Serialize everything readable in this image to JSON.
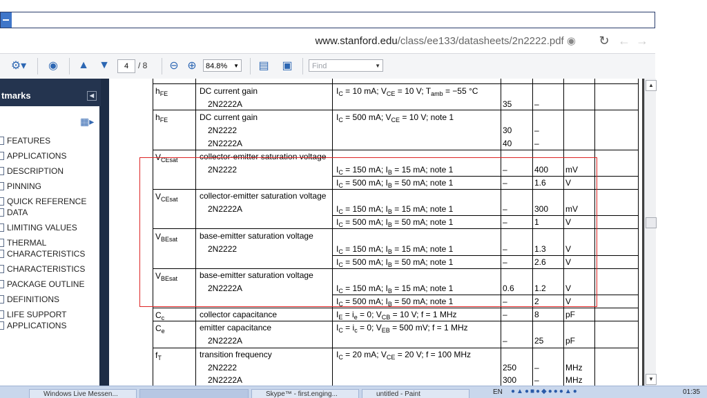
{
  "browser": {
    "url_host": "www.stanford.edu",
    "url_path": "/class/ee133/datasheets/2n2222.pdf"
  },
  "toolbar": {
    "page_current": "4",
    "page_total": "/ 8",
    "zoom": "84.8%",
    "find_placeholder": "Find"
  },
  "sidebar": {
    "title": "tmarks",
    "bookmarks": [
      "FEATURES",
      "APPLICATIONS",
      "DESCRIPTION",
      "PINNING",
      "QUICK REFERENCE",
      "DATA",
      "LIMITING VALUES",
      "THERMAL",
      "CHARACTERISTICS",
      "CHARACTERISTICS",
      "PACKAGE OUTLINE",
      "DEFINITIONS",
      "LIFE SUPPORT",
      "APPLICATIONS"
    ]
  },
  "table": {
    "rows": [
      {
        "sym": "h",
        "sym_sub": "FE",
        "desc": "DC current gain",
        "sub": "2N2222A",
        "cond": "I",
        "cond_sub": "C",
        "cond_rest": " = 10 mA; V",
        "cond_sub2": "CE",
        "cond_rest2": " = 10 V; T",
        "cond_sub3": "amb",
        "cond_rest3": " = −55 °C",
        "min": "35",
        "max": "–",
        "unit": ""
      },
      {
        "sym": "h",
        "sym_sub": "FE",
        "desc": "DC current gain",
        "cond": "I",
        "cond_sub": "C",
        "cond_rest": " = 500 mA; V",
        "cond_sub2": "CE",
        "cond_rest2": " = 10 V; note 1",
        "lines": [
          {
            "label": "2N2222",
            "min": "30",
            "max": "–"
          },
          {
            "label": "2N2222A",
            "min": "40",
            "max": "–"
          }
        ]
      },
      {
        "sym": "V",
        "sym_sub": "CEsat",
        "desc": "collector-emitter saturation voltage",
        "sub": "2N2222",
        "conds": [
          {
            "a": "I",
            "as": "C",
            "b": " = 150 mA; I",
            "bs": "B",
            "c": " = 15 mA; note 1",
            "min": "–",
            "max": "400",
            "unit": "mV"
          },
          {
            "a": "I",
            "as": "C",
            "b": " = 500 mA; I",
            "bs": "B",
            "c": " = 50 mA; note 1",
            "min": "–",
            "max": "1.6",
            "unit": "V"
          }
        ]
      },
      {
        "sym": "V",
        "sym_sub": "CEsat",
        "desc": "collector-emitter saturation voltage",
        "sub": "2N2222A",
        "conds": [
          {
            "a": "I",
            "as": "C",
            "b": " = 150 mA; I",
            "bs": "B",
            "c": " = 15 mA; note 1",
            "min": "–",
            "max": "300",
            "unit": "mV"
          },
          {
            "a": "I",
            "as": "C",
            "b": " = 500 mA; I",
            "bs": "B",
            "c": " = 50 mA; note 1",
            "min": "–",
            "max": "1",
            "unit": "V"
          }
        ]
      },
      {
        "sym": "V",
        "sym_sub": "BEsat",
        "desc": "base-emitter saturation voltage",
        "sub": "2N2222",
        "conds": [
          {
            "a": "I",
            "as": "C",
            "b": " = 150 mA; I",
            "bs": "B",
            "c": " = 15 mA; note 1",
            "min": "–",
            "max": "1.3",
            "unit": "V"
          },
          {
            "a": "I",
            "as": "C",
            "b": " = 500 mA; I",
            "bs": "B",
            "c": " = 50 mA; note 1",
            "min": "–",
            "max": "2.6",
            "unit": "V"
          }
        ]
      },
      {
        "sym": "V",
        "sym_sub": "BEsat",
        "desc": "base-emitter saturation voltage",
        "sub": "2N2222A",
        "conds": [
          {
            "a": "I",
            "as": "C",
            "b": " = 150 mA; I",
            "bs": "B",
            "c": " = 15 mA; note 1",
            "min": "0.6",
            "max": "1.2",
            "unit": "V"
          },
          {
            "a": "I",
            "as": "C",
            "b": " = 500 mA; I",
            "bs": "B",
            "c": " = 50 mA; note 1",
            "min": "–",
            "max": "2",
            "unit": "V"
          }
        ]
      },
      {
        "sym": "C",
        "sym_sub": "c",
        "desc": "collector capacitance",
        "cond_full": "I",
        "cond_full_s1": "E",
        "cond_full_2": " = i",
        "cond_full_s2": "e",
        "cond_full_3": " = 0; V",
        "cond_full_s3": "CB",
        "cond_full_4": " = 10 V; f = 1 MHz",
        "min": "–",
        "max": "8",
        "unit": "pF"
      },
      {
        "sym": "C",
        "sym_sub": "e",
        "desc": "emitter capacitance",
        "sub": "2N2222A",
        "cond_full": "I",
        "cond_full_s1": "C",
        "cond_full_2": " = i",
        "cond_full_s2": "c",
        "cond_full_3": " = 0; V",
        "cond_full_s3": "EB",
        "cond_full_4": " = 500 mV; f = 1 MHz",
        "min": "–",
        "max": "25",
        "unit": "pF"
      },
      {
        "sym": "f",
        "sym_sub": "T",
        "desc": "transition frequency",
        "cond_full": "I",
        "cond_full_s1": "C",
        "cond_full_2": " = 20 mA; V",
        "cond_full_s2": "CE",
        "cond_full_3": " = 20 V; f = 100 MHz",
        "lines": [
          {
            "label": "2N2222",
            "min": "250",
            "max": "–",
            "unit": "MHz"
          },
          {
            "label": "2N2222A",
            "min": "300",
            "max": "–",
            "unit": "MHz"
          }
        ]
      }
    ]
  },
  "taskbar": {
    "tasks": [
      "Windows Live Messen...",
      "",
      "Skype™ - first.enging...",
      "untitled - Paint"
    ],
    "tray_lang": "EN",
    "clock": "01:35"
  }
}
